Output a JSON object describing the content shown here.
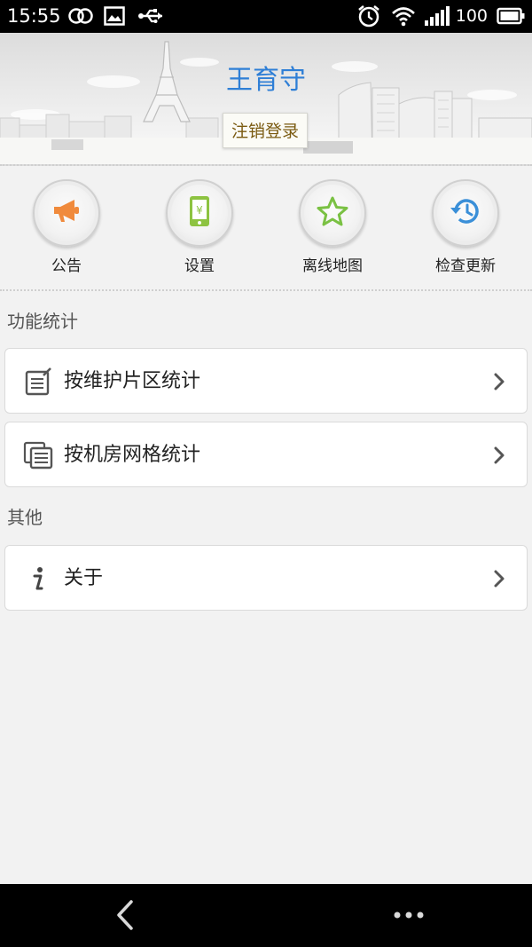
{
  "status_bar": {
    "time": "15:55",
    "battery": "100",
    "left_icons": [
      "infinity-icon",
      "image-icon",
      "usb-icon"
    ],
    "right_icons": [
      "alarm-icon",
      "wifi-icon",
      "signal-icon",
      "battery-icon"
    ]
  },
  "header": {
    "user_name": "王育守",
    "logout_label": "注销登录",
    "background": "city-skyline-eiffel-tower"
  },
  "quick_actions": [
    {
      "label": "公告",
      "icon": "megaphone-icon",
      "color": "#f08a3c"
    },
    {
      "label": "设置",
      "icon": "phone-yuan-icon",
      "color": "#8dc341"
    },
    {
      "label": "离线地图",
      "icon": "star-icon",
      "color": "#7ac143"
    },
    {
      "label": "检查更新",
      "icon": "history-icon",
      "color": "#3a8fd8"
    }
  ],
  "sections": [
    {
      "title": "功能统计",
      "items": [
        {
          "label": "按维护片区统计",
          "icon": "edit-document-icon"
        },
        {
          "label": "按机房网格统计",
          "icon": "copy-document-icon"
        }
      ]
    },
    {
      "title": "其他",
      "items": [
        {
          "label": "关于",
          "icon": "info-icon"
        }
      ]
    }
  ],
  "nav_bar": {
    "icons": [
      "back-icon",
      "more-icon"
    ]
  },
  "colors": {
    "accent_blue": "#2f7fd6",
    "background": "#f2f2f2"
  }
}
